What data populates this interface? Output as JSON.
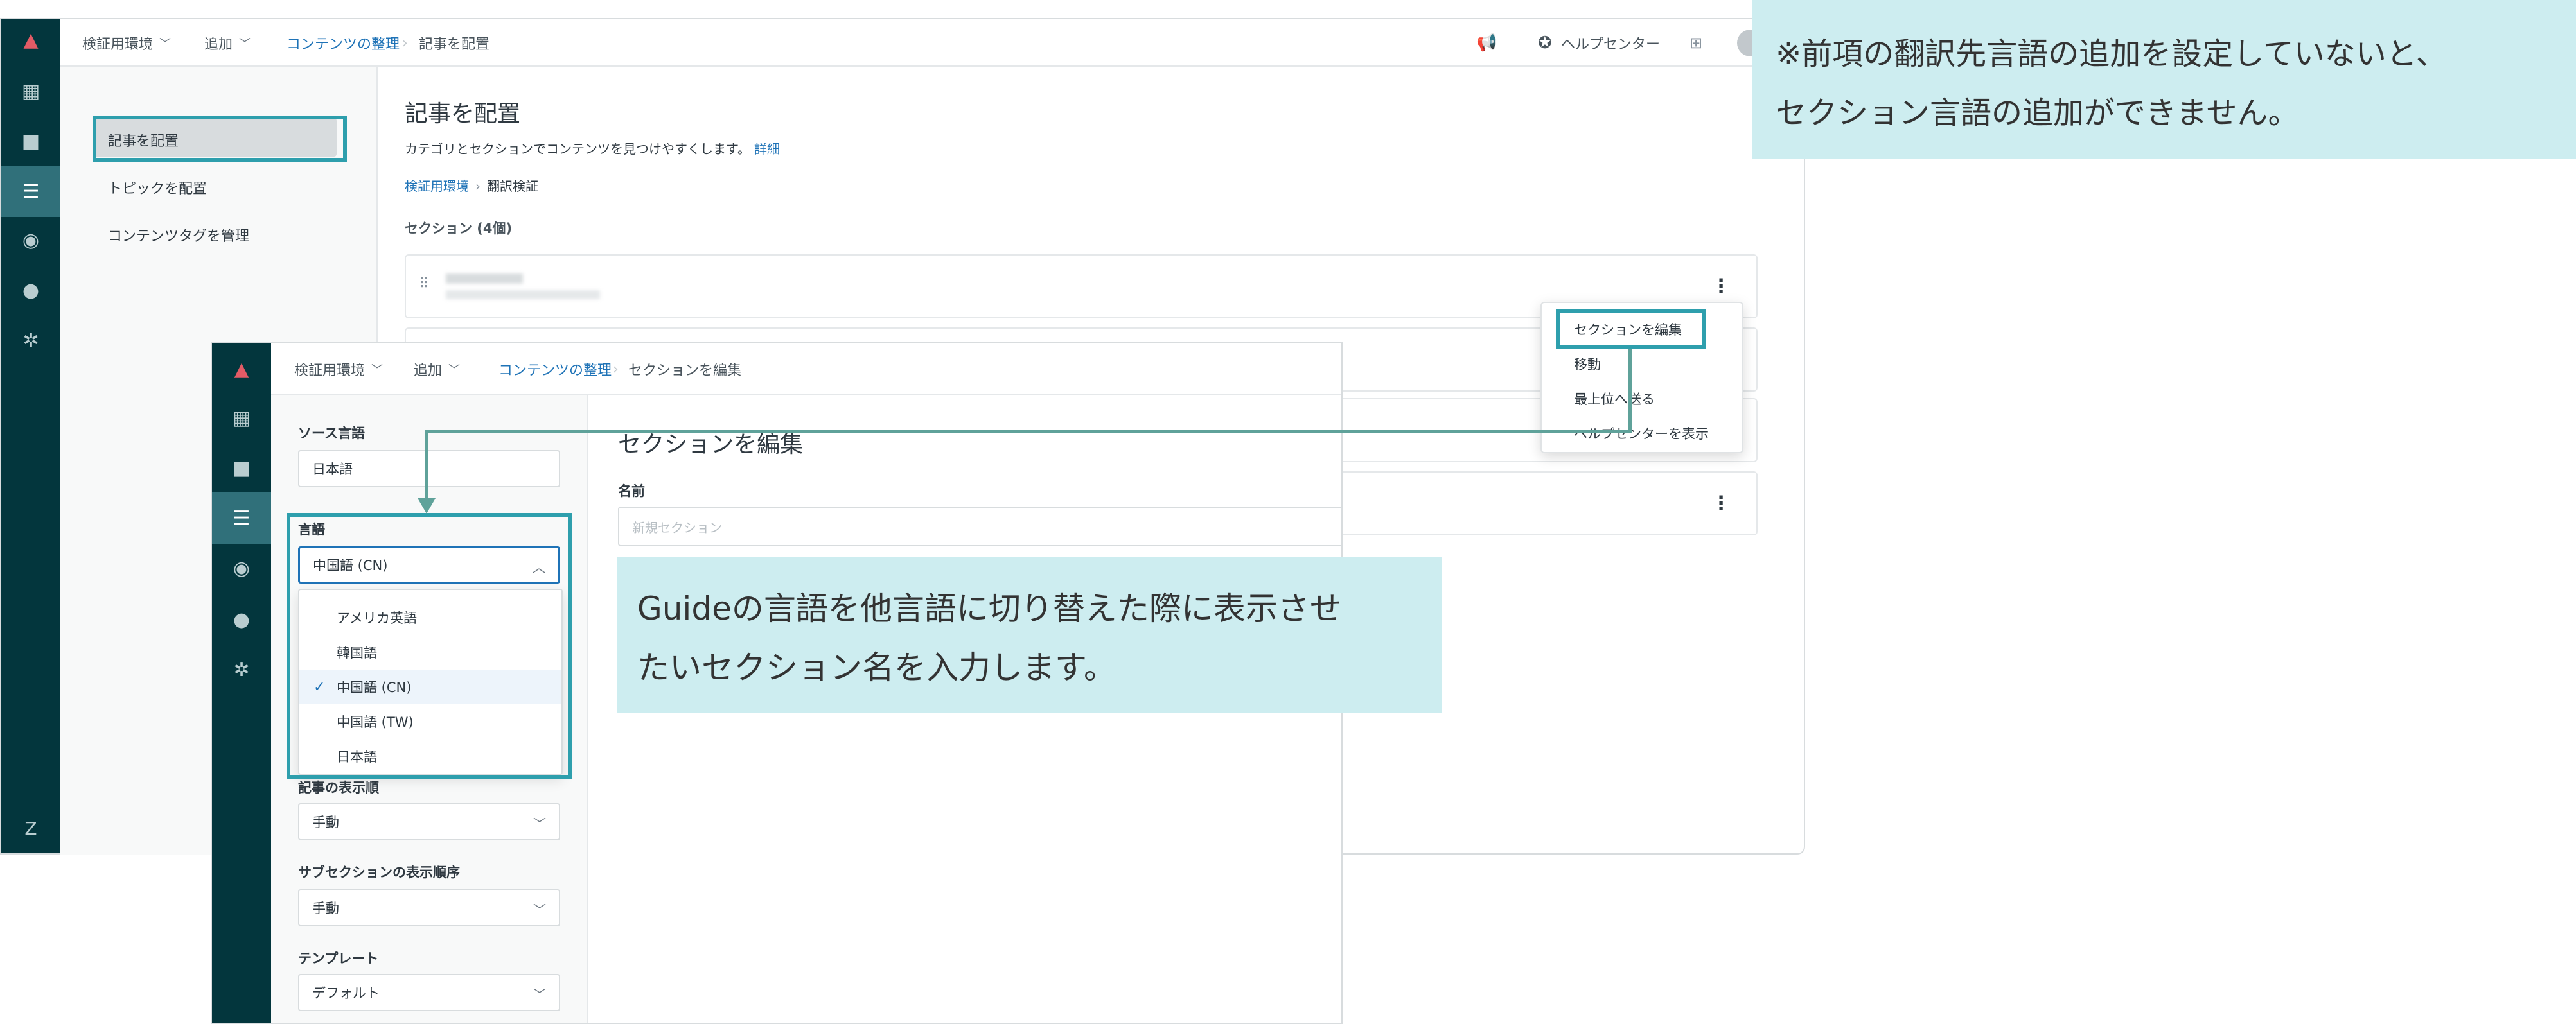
{
  "back": {
    "topbar": {
      "env": "検証用環境",
      "add": "追加",
      "breadcrumb_link": "コンテンツの整理",
      "breadcrumb_current": "記事を配置",
      "help_center": "ヘルプセンター"
    },
    "sidebar": {
      "items": [
        "記事を配置",
        "トピックを配置",
        "コンテンツタグを管理"
      ]
    },
    "main": {
      "title": "記事を配置",
      "description": "カテゴリとセクションでコンテンツを見つけやすくします。",
      "details_link": "詳細",
      "breadcrumb_link": "検証用環境",
      "breadcrumb_current": "翻訳検証",
      "sections_label": "セクション (4個)"
    },
    "context_menu": {
      "items": [
        "セクションを編集",
        "移動",
        "最上位へ送る",
        "ヘルプセンターを表示"
      ]
    }
  },
  "front": {
    "topbar": {
      "env": "検証用環境",
      "add": "追加",
      "breadcrumb_link": "コンテンツの整理",
      "breadcrumb_current": "セクションを編集"
    },
    "sidebar": {
      "source_language_label": "ソース言語",
      "source_language_value": "日本語",
      "language_label": "言語",
      "language_value": "中国語 (CN)",
      "language_options": [
        "アメリカ英語",
        "韓国語",
        "中国語 (CN)",
        "中国語 (TW)",
        "日本語"
      ],
      "selected_option": "中国語 (CN)",
      "article_order_label": "記事の表示順",
      "article_order_value": "手動",
      "subsection_order_label": "サブセクションの表示順序",
      "subsection_order_value": "手動",
      "template_label": "テンプレート",
      "template_value": "デフォルト"
    },
    "main": {
      "title": "セクションを編集",
      "name_label": "名前",
      "name_placeholder": "新規セクション"
    }
  },
  "callouts": {
    "top_right_line1": "※前項の翻訳先言語の追加を設定していないと、",
    "top_right_line2": "セクション言語の追加ができません。",
    "center_line1": "Guideの言語を他言語に切り替えた際に表示させ",
    "center_line2": "たいセクション名を入力します。"
  },
  "colors": {
    "rail": "#03363d",
    "highlight": "#2e9fad",
    "callout_bg": "#cdedf0",
    "link": "#1f73b7"
  }
}
